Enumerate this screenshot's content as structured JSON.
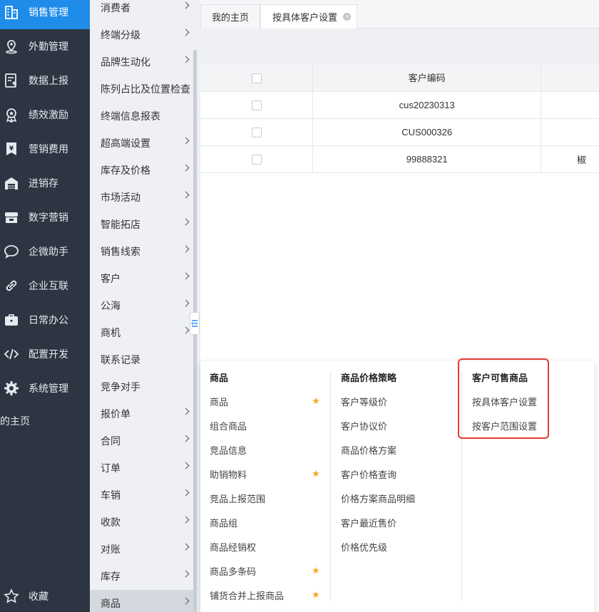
{
  "sidebar": {
    "items": [
      {
        "label": "销售管理",
        "icon": "building-icon",
        "active": true
      },
      {
        "label": "外勤管理",
        "icon": "location-pin-icon"
      },
      {
        "label": "数据上报",
        "icon": "report-upload-icon"
      },
      {
        "label": "绩效激励",
        "icon": "award-icon"
      },
      {
        "label": "营销费用",
        "icon": "yen-bookmark-icon"
      },
      {
        "label": "进销存",
        "icon": "warehouse-icon"
      },
      {
        "label": "数字营销",
        "icon": "shop-icon"
      },
      {
        "label": "企微助手",
        "icon": "chat-bubble-icon"
      },
      {
        "label": "企业互联",
        "icon": "link-icon"
      },
      {
        "label": "日常办公",
        "icon": "briefcase-icon"
      },
      {
        "label": "配置开发",
        "icon": "code-icon"
      },
      {
        "label": "系统管理",
        "icon": "gear-icon"
      }
    ],
    "home_text": "的主页",
    "favorites_label": "收藏"
  },
  "submenu": {
    "items": [
      {
        "label": "消费者",
        "arrow": true
      },
      {
        "label": "终端分级",
        "arrow": true
      },
      {
        "label": "品牌生动化",
        "arrow": true
      },
      {
        "label": "陈列占比及位置检查",
        "arrow": false
      },
      {
        "label": "终端信息报表",
        "arrow": false
      },
      {
        "label": "超高端设置",
        "arrow": true
      },
      {
        "label": "库存及价格",
        "arrow": true
      },
      {
        "label": "市场活动",
        "arrow": true
      },
      {
        "label": "智能拓店",
        "arrow": true
      },
      {
        "label": "销售线索",
        "arrow": true
      },
      {
        "label": "客户",
        "arrow": true
      },
      {
        "label": "公海",
        "arrow": true
      },
      {
        "label": "商机",
        "arrow": true
      },
      {
        "label": "联系记录",
        "arrow": false
      },
      {
        "label": "竞争对手",
        "arrow": false
      },
      {
        "label": "报价单",
        "arrow": true
      },
      {
        "label": "合同",
        "arrow": true
      },
      {
        "label": "订单",
        "arrow": true
      },
      {
        "label": "车销",
        "arrow": true
      },
      {
        "label": "收款",
        "arrow": true
      },
      {
        "label": "对账",
        "arrow": true
      },
      {
        "label": "库存",
        "arrow": true
      },
      {
        "label": "商品",
        "arrow": true,
        "active": true
      }
    ]
  },
  "tabs": [
    {
      "label": "我的主页",
      "active": false
    },
    {
      "label": "按具体客户设置",
      "active": true,
      "closable": true
    }
  ],
  "table": {
    "headers": [
      "客户编码"
    ],
    "rows": [
      {
        "code": "cus20230313",
        "extra": ""
      },
      {
        "code": "CUS000326",
        "extra": ""
      },
      {
        "code": "99888321",
        "extra": "椒"
      }
    ]
  },
  "flyout": {
    "columns": [
      {
        "title": "商品",
        "items": [
          {
            "label": "商品",
            "starred": true
          },
          {
            "label": "组合商品",
            "starred": false
          },
          {
            "label": "竞品信息",
            "starred": false
          },
          {
            "label": "助销物料",
            "starred": true
          },
          {
            "label": "竞品上报范围",
            "starred": false
          },
          {
            "label": "商品组",
            "starred": false
          },
          {
            "label": "商品经销权",
            "starred": false
          },
          {
            "label": "商品多条码",
            "starred": true
          },
          {
            "label": "铺货合并上报商品",
            "starred": true
          }
        ]
      },
      {
        "title": "商品价格策略",
        "items": [
          {
            "label": "客户等级价"
          },
          {
            "label": "客户协议价"
          },
          {
            "label": "商品价格方案"
          },
          {
            "label": "客户价格查询"
          },
          {
            "label": "价格方案商品明细"
          },
          {
            "label": "客户最近售价"
          },
          {
            "label": "价格优先级"
          }
        ]
      },
      {
        "title": "客户可售商品",
        "items": [
          {
            "label": "按具体客户设置"
          },
          {
            "label": "按客户范围设置"
          }
        ]
      }
    ]
  },
  "colors": {
    "sidebar_bg": "#2d3542",
    "active_blue": "#1f8cea",
    "star": "#f5a623",
    "highlight": "#e53935"
  }
}
